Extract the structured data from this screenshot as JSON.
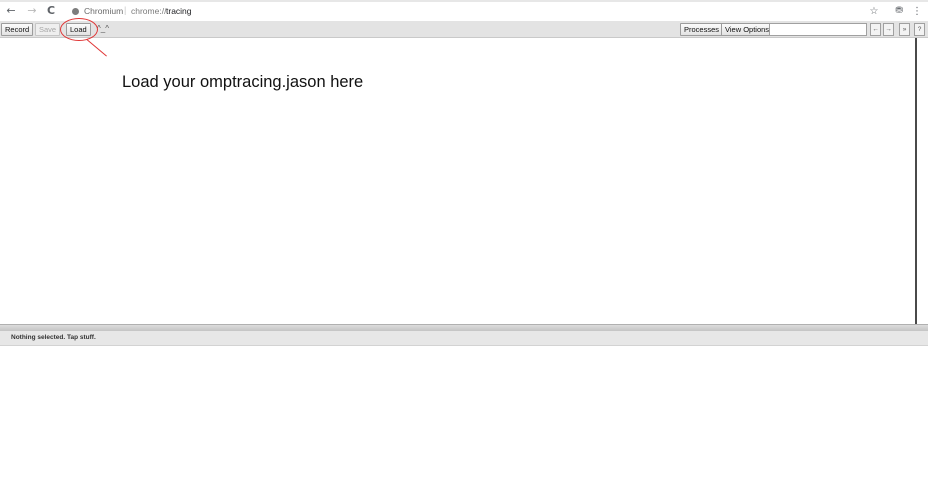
{
  "browser": {
    "back_glyph": "←",
    "forward_glyph": "→",
    "reload_glyph": "C",
    "site_name": "Chromium",
    "url_separator": "|",
    "url_scheme": "chrome://",
    "url_host": "tracing",
    "bookmark_glyph": "☆",
    "extension_glyph": "⛃",
    "menu_glyph": "⋮",
    "icons": {
      "back": "arrow-left",
      "forward": "arrow-right",
      "reload": "reload",
      "site": "site-info",
      "bookmark": "star",
      "extension": "extension",
      "menu": "kebab-menu"
    }
  },
  "toolbar": {
    "record_label": "Record",
    "save_label": "Save",
    "load_label": "Load",
    "face_text": "^_^",
    "processes_label": "Processes",
    "view_options_label": "View Options",
    "search_value": "",
    "prev_label": "←",
    "next_label": "→",
    "all_label": "»",
    "help_label": "?"
  },
  "annotation": {
    "text": "Load your omptracing.jason here",
    "color": "#e03636"
  },
  "analysis": {
    "selection_text": "Nothing selected. Tap stuff."
  }
}
